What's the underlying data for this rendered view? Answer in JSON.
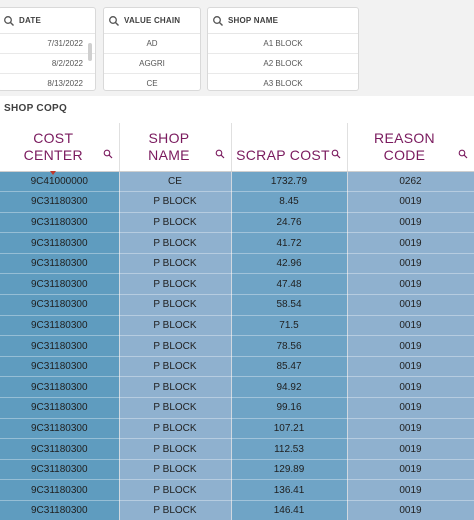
{
  "filters": {
    "date": {
      "title": "DATE",
      "items": [
        "7/31/2022",
        "8/2/2022",
        "8/13/2022"
      ]
    },
    "value_chain": {
      "title": "VALUE CHAIN",
      "items": [
        "AD",
        "AGGRI",
        "CE"
      ]
    },
    "shop_name": {
      "title": "SHOP NAME",
      "items": [
        "A1 BLOCK",
        "A2 BLOCK",
        "A3 BLOCK"
      ]
    }
  },
  "table": {
    "title": "SHOP COPQ",
    "headers": [
      [
        "COST",
        "CENTER"
      ],
      [
        "SHOP",
        "NAME"
      ],
      [
        "",
        "SCRAP COST"
      ],
      [
        "REASON",
        "CODE"
      ]
    ],
    "rows": [
      [
        "9C41000000",
        "CE",
        "1732.79",
        "0262"
      ],
      [
        "9C31180300",
        "P BLOCK",
        "8.45",
        "0019"
      ],
      [
        "9C31180300",
        "P BLOCK",
        "24.76",
        "0019"
      ],
      [
        "9C31180300",
        "P BLOCK",
        "41.72",
        "0019"
      ],
      [
        "9C31180300",
        "P BLOCK",
        "42.96",
        "0019"
      ],
      [
        "9C31180300",
        "P BLOCK",
        "47.48",
        "0019"
      ],
      [
        "9C31180300",
        "P BLOCK",
        "58.54",
        "0019"
      ],
      [
        "9C31180300",
        "P BLOCK",
        "71.5",
        "0019"
      ],
      [
        "9C31180300",
        "P BLOCK",
        "78.56",
        "0019"
      ],
      [
        "9C31180300",
        "P BLOCK",
        "85.47",
        "0019"
      ],
      [
        "9C31180300",
        "P BLOCK",
        "94.92",
        "0019"
      ],
      [
        "9C31180300",
        "P BLOCK",
        "99.16",
        "0019"
      ],
      [
        "9C31180300",
        "P BLOCK",
        "107.21",
        "0019"
      ],
      [
        "9C31180300",
        "P BLOCK",
        "112.53",
        "0019"
      ],
      [
        "9C31180300",
        "P BLOCK",
        "129.89",
        "0019"
      ],
      [
        "9C31180300",
        "P BLOCK",
        "136.41",
        "0019"
      ],
      [
        "9C31180300",
        "P BLOCK",
        "146.41",
        "0019"
      ]
    ]
  },
  "colors": {
    "header_text": "#7a1a5e",
    "col_dark": "#5f9cbf",
    "col_light": "#8fb1cf"
  },
  "icons": {
    "pane_icon": "search-icon",
    "header_icon": "search-icon"
  }
}
